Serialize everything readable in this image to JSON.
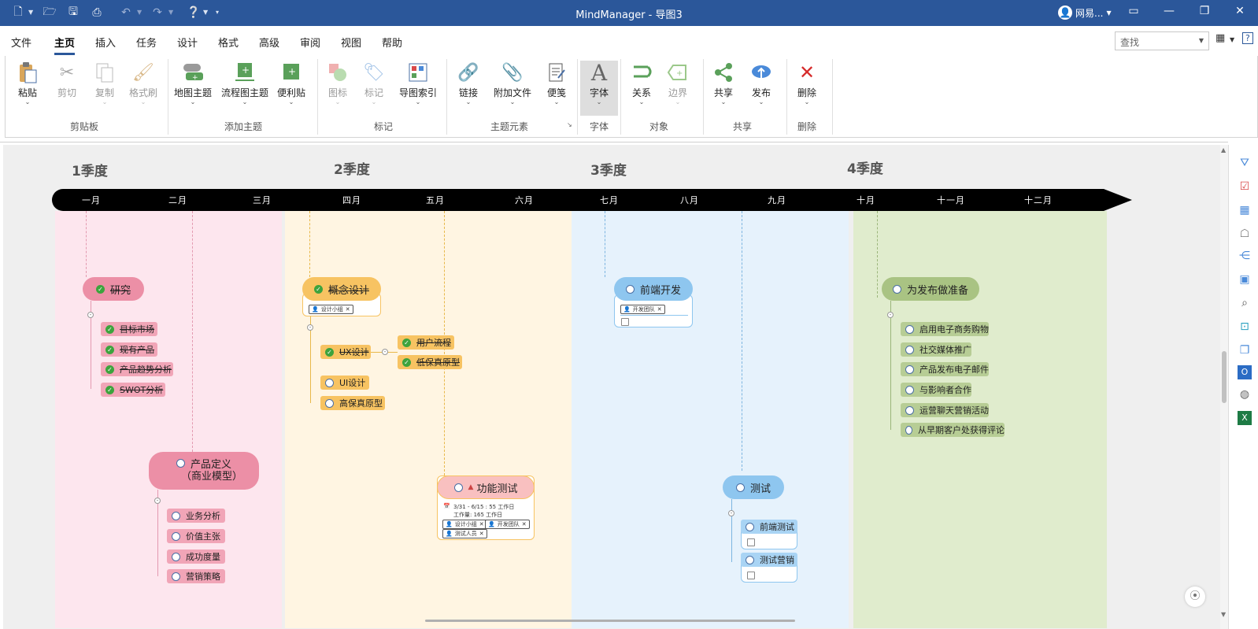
{
  "window": {
    "title": "MindManager - 导图3",
    "user": "网易...",
    "quick_access": [
      "new-icon",
      "open-icon",
      "save-icon",
      "print-icon",
      "undo-icon",
      "redo-icon",
      "help-icon",
      "customize-icon"
    ]
  },
  "menu": {
    "tabs": [
      "文件",
      "主页",
      "插入",
      "任务",
      "设计",
      "格式",
      "高级",
      "审阅",
      "视图",
      "帮助"
    ],
    "active": "主页",
    "search_placeholder": "查找"
  },
  "ribbon": {
    "buttons": [
      {
        "label": "粘贴",
        "icon": "paste-icon",
        "enabled": true
      },
      {
        "label": "剪切",
        "icon": "cut-icon",
        "enabled": false
      },
      {
        "label": "复制",
        "icon": "copy-icon",
        "enabled": false
      },
      {
        "label": "格式刷",
        "icon": "format-painter-icon",
        "enabled": false
      },
      {
        "label": "地图主题",
        "icon": "map-topic-icon",
        "enabled": true
      },
      {
        "label": "流程图主题",
        "icon": "flowchart-topic-icon",
        "enabled": true
      },
      {
        "label": "便利贴",
        "icon": "sticky-note-icon",
        "enabled": true
      },
      {
        "label": "图标",
        "icon": "icon-marker-icon",
        "enabled": false
      },
      {
        "label": "标记",
        "icon": "tag-icon",
        "enabled": false
      },
      {
        "label": "导图索引",
        "icon": "map-index-icon",
        "enabled": true
      },
      {
        "label": "链接",
        "icon": "link-icon",
        "enabled": true
      },
      {
        "label": "附加文件",
        "icon": "attach-icon",
        "enabled": true
      },
      {
        "label": "便笺",
        "icon": "notes-icon",
        "enabled": true
      },
      {
        "label": "字体",
        "icon": "font-icon",
        "enabled": true
      },
      {
        "label": "关系",
        "icon": "relationship-icon",
        "enabled": true
      },
      {
        "label": "边界",
        "icon": "boundary-icon",
        "enabled": false
      },
      {
        "label": "共享",
        "icon": "share-icon",
        "enabled": true
      },
      {
        "label": "发布",
        "icon": "publish-icon",
        "enabled": true
      },
      {
        "label": "删除",
        "icon": "delete-icon",
        "enabled": true
      }
    ],
    "groups": [
      "剪贴板",
      "添加主题",
      "标记",
      "主题元素",
      "字体",
      "对象",
      "共享",
      "删除"
    ]
  },
  "timeline": {
    "quarters": [
      "1季度",
      "2季度",
      "3季度",
      "4季度"
    ],
    "months": [
      "一月",
      "二月",
      "三月",
      "四月",
      "五月",
      "六月",
      "七月",
      "八月",
      "九月",
      "十月",
      "十一月",
      "十二月"
    ]
  },
  "topics": {
    "research": {
      "title": "研究",
      "done": true,
      "subs": [
        "目标市场",
        "现有产品",
        "产品趋势分析",
        "SWOT分析"
      ]
    },
    "product_def": {
      "title_line1": "产品定义",
      "title_line2": "（商业模型）",
      "done": false,
      "subs": [
        "业务分析",
        "价值主张",
        "成功度量",
        "营销策略"
      ]
    },
    "concept": {
      "title": "概念设计",
      "done": true,
      "tag": "设计小组"
    },
    "ux": {
      "title": "UX设计",
      "done": true,
      "subs": [
        "用户流程",
        "低保真原型"
      ]
    },
    "ui": {
      "title": "UI设计",
      "done": false
    },
    "hifi": {
      "title": "高保真原型",
      "done": false
    },
    "func_test": {
      "title": "功能测试",
      "done": false,
      "dates": "3/31 - 6/15 : 55 工作日",
      "effort": "工作量: 165 工作日",
      "tags": [
        "设计小组",
        "开发团队",
        "测试人员"
      ]
    },
    "frontend": {
      "title": "前端开发",
      "done": false,
      "tag": "开发团队"
    },
    "testing": {
      "title": "测试",
      "done": false,
      "subs": [
        "前端测试",
        "测试营销"
      ]
    },
    "launch": {
      "title": "为发布做准备",
      "done": false,
      "subs": [
        "启用电子商务购物",
        "社交媒体推广",
        "产品发布电子邮件",
        "与影响者合作",
        "运营聊天营销活动",
        "从早期客户处获得评论"
      ]
    }
  },
  "colors": {
    "titlebar": "#2b579a",
    "q1": "#fde6ee",
    "q2": "#fff5e2",
    "q3": "#e6f2fc",
    "q4": "#e0eccd",
    "pink": "#ec8fa6",
    "pink_sub": "#f1a5b7",
    "orange": "#f7c362",
    "orange_sub": "#f7c362",
    "blue": "#8ec6ef",
    "blue_sub": "#a9d4f4",
    "green": "#a9c383",
    "green_sub": "#b7cd95",
    "timeline": "#000000"
  },
  "sidebar_icons": [
    "filter-icon",
    "task-icon",
    "calendar-icon",
    "resource-icon",
    "map-parts-icon",
    "image-icon",
    "search-icon",
    "capture-icon",
    "multi-map-icon",
    "outlook-icon",
    "web-icon",
    "excel-icon"
  ]
}
